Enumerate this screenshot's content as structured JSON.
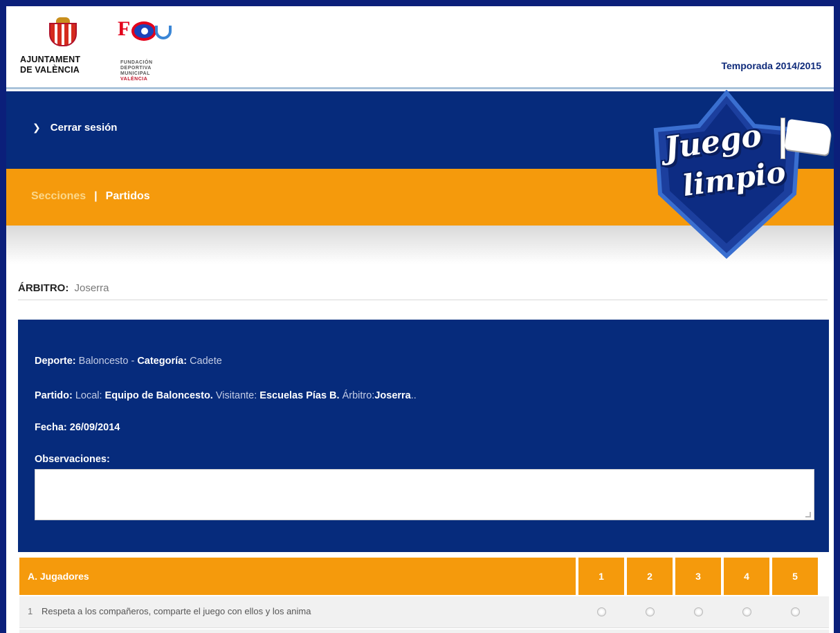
{
  "header": {
    "logo_left_line1": "AJUNTAMENT",
    "logo_left_line2": "DE VALÈNCIA",
    "logo_right_letter": "F",
    "logo_right_lines": [
      "FUNDACIÓN",
      "DEPORTIVA",
      "MUNICIPAL",
      "VALÈNCIA"
    ],
    "season": "Temporada 2014/2015"
  },
  "topbar": {
    "logout_icon": "chevron-right-icon",
    "logout_label": "Cerrar sesión"
  },
  "nav": {
    "items": [
      "Secciones",
      "Partidos"
    ],
    "separator": "|"
  },
  "badge": {
    "word1": "Juego",
    "word2": "limpio"
  },
  "referee": {
    "label": "ÁRBITRO:",
    "name": "Joserra"
  },
  "info": {
    "deporte_label": "Deporte:",
    "deporte_value": "Baloncesto",
    "dash": "-",
    "categoria_label": "Categoría:",
    "categoria_value": "Cadete",
    "partido_label": "Partido:",
    "local_label": "Local:",
    "local_value": "Equipo de Baloncesto.",
    "visitante_label": "Visitante:",
    "visitante_value": "Escuelas Pías B.",
    "arbitro_label": "Árbitro:",
    "arbitro_value": "Joserra",
    "arbitro_suffix": "..",
    "fecha": "Fecha: 26/09/2014",
    "observaciones_label": "Observaciones:",
    "observaciones_value": ""
  },
  "table": {
    "header": "A. Jugadores",
    "scores": [
      "1",
      "2",
      "3",
      "4",
      "5"
    ],
    "rows": [
      {
        "index": "1",
        "question": "Respeta a los compañeros, comparte el juego con ellos y los anima"
      }
    ]
  },
  "colors": {
    "frame": "#0b1f7a",
    "navy": "#062b7c",
    "orange": "#f59a0c",
    "nav_active": "#fbd78a"
  }
}
